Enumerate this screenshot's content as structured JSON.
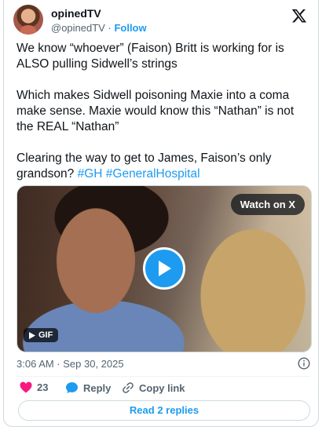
{
  "author": {
    "display_name": "opinedTV",
    "handle": "@opinedTV",
    "separator": "·",
    "follow_label": "Follow"
  },
  "post": {
    "paragraphs": [
      "We know “whoever” (Faison) Britt is working for is ALSO pulling Sidwell’s strings",
      "Which makes Sidwell poisoning Maxie into a coma make sense. Maxie would know this “Nathan” is not the REAL “Nathan”"
    ],
    "last_paragraph_text": "Clearing the way to get to James, Faison’s only grandson?",
    "hashtags": [
      "#GH",
      "#GeneralHospital"
    ]
  },
  "media": {
    "watch_label": "Watch on X",
    "gif_label": "GIF"
  },
  "meta": {
    "timestamp": "3:06 AM · Sep 30, 2025"
  },
  "actions": {
    "like_count": "23",
    "reply_label": "Reply",
    "copy_link_label": "Copy link",
    "read_replies_label": "Read 2 replies"
  },
  "colors": {
    "accent": "#1d9bf0",
    "like": "#f91880",
    "text": "#0f1419",
    "muted": "#536471"
  }
}
